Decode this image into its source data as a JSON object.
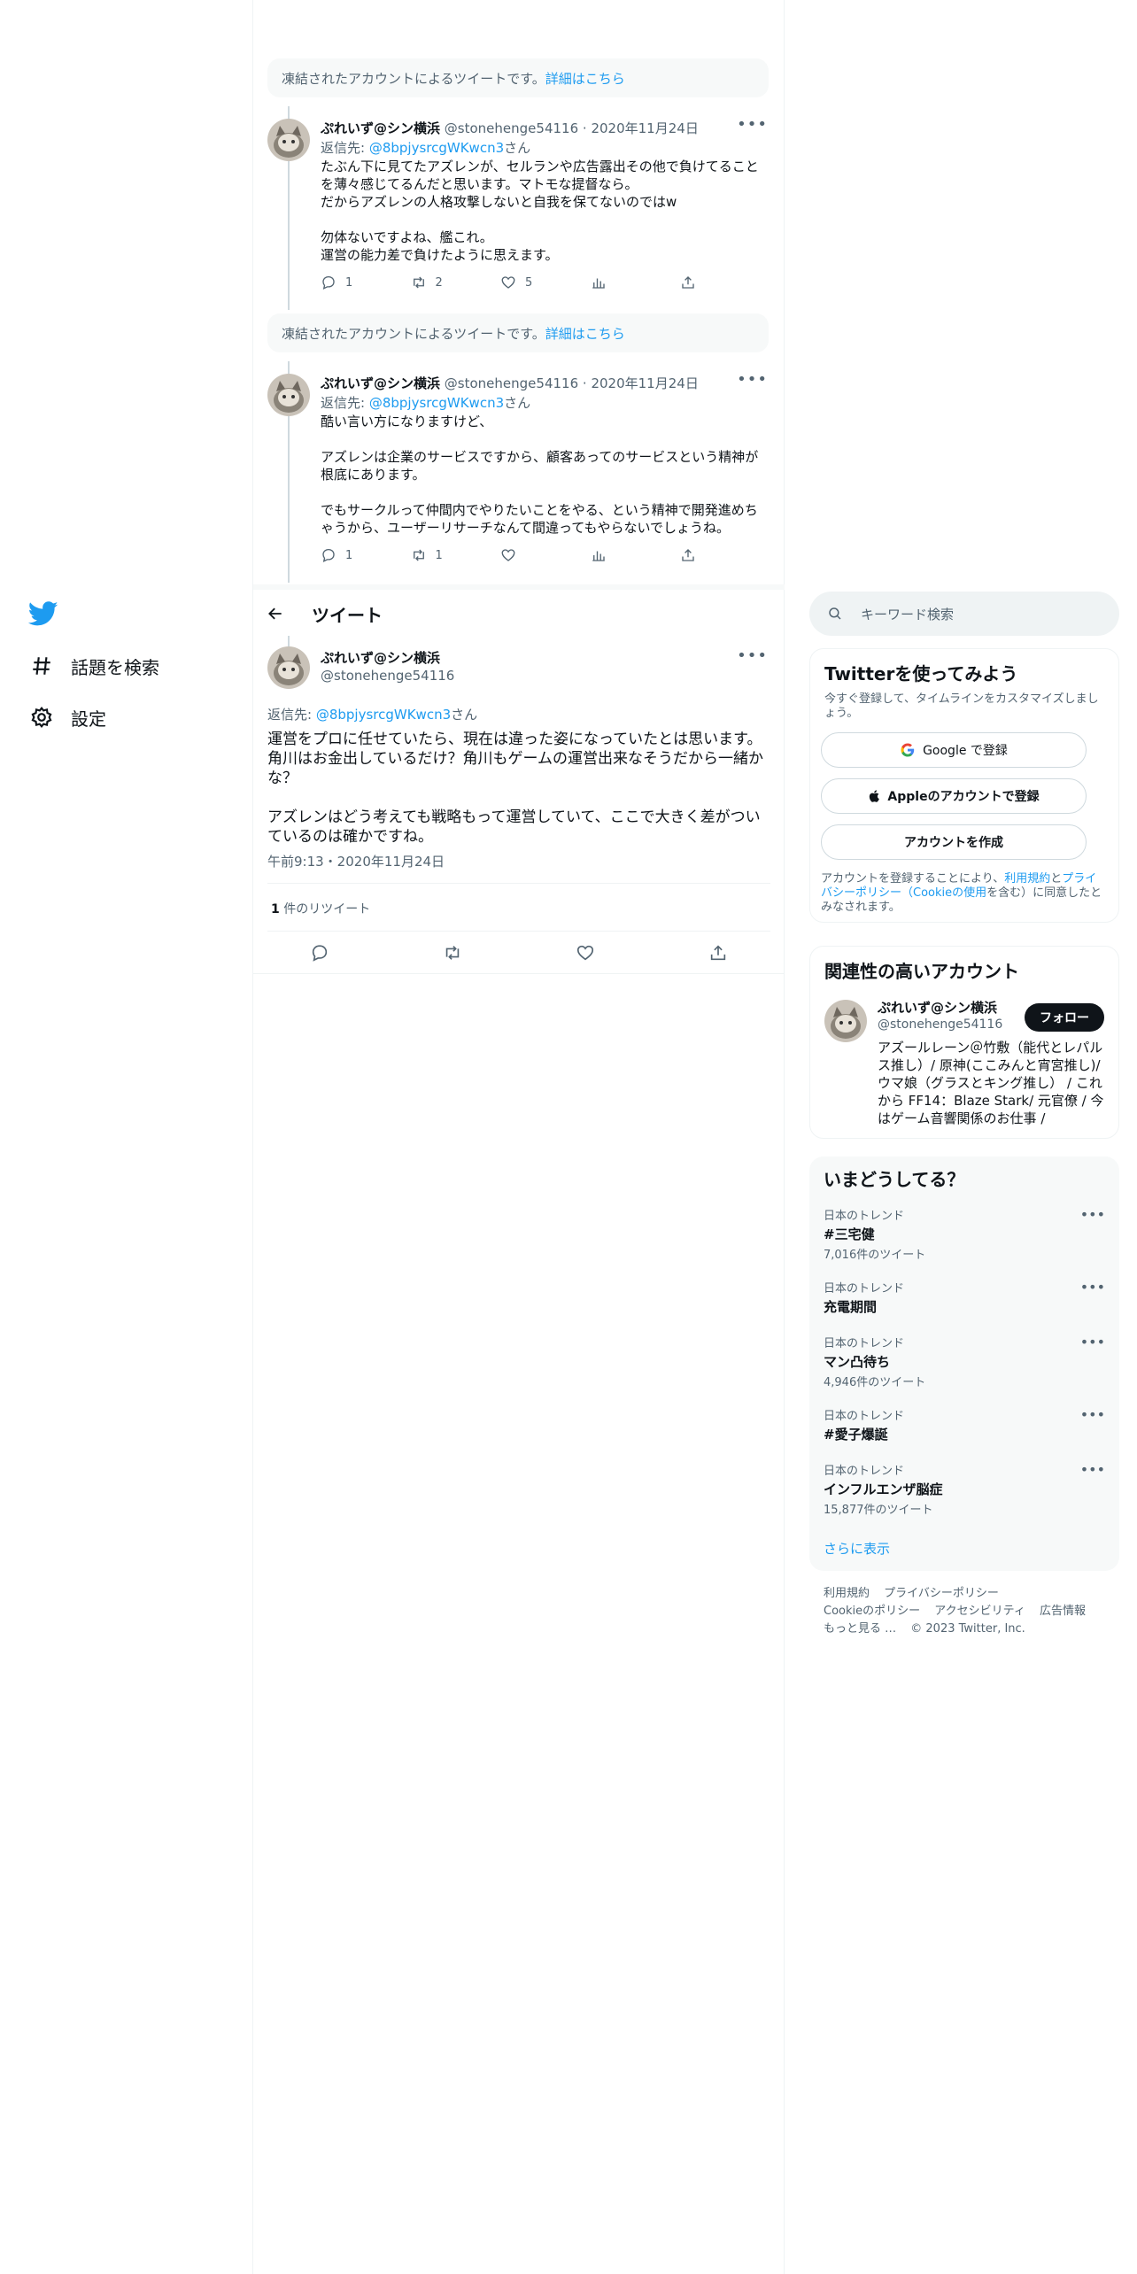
{
  "colors": {
    "accent": "#1d9bf0",
    "text": "#0f1419",
    "muted": "#536471",
    "border": "#eff3f4"
  },
  "nav": {
    "logo_icon": "twitter-bird-icon",
    "items": [
      {
        "icon": "hashtag-icon",
        "label": "話題を検索"
      },
      {
        "icon": "gear-icon",
        "label": "設定"
      }
    ]
  },
  "thread": {
    "notices": [
      {
        "text": "凍結されたアカウントによるツイートです。",
        "link": "詳細はこちら"
      },
      {
        "text": "凍結されたアカウントによるツイートです。",
        "link": "詳細はこちら"
      }
    ],
    "tweets": [
      {
        "name": "ぷれいず@シン横浜",
        "handle": "@stonehenge54116",
        "date": "2020年11月24日",
        "reply_prefix": "返信先: ",
        "reply_to": "@8bpjysrcgWKwcn3",
        "reply_suffix": "さん",
        "text": "たぶん下に見てたアズレンが、セルランや広告露出その他で負けてることを薄々感じてるんだと思います。マトモな提督なら。\nだからアズレンの人格攻撃しないと自我を保てないのではw\n\n勿体ないですよね、艦これ。\n運営の能力差で負けたように思えます。",
        "replies": "1",
        "retweets": "2",
        "likes": "5"
      },
      {
        "name": "ぷれいず@シン横浜",
        "handle": "@stonehenge54116",
        "date": "2020年11月24日",
        "reply_prefix": "返信先: ",
        "reply_to": "@8bpjysrcgWKwcn3",
        "reply_suffix": "さん",
        "text": "酷い言い方になりますけど、\n\nアズレンは企業のサービスですから、顧客あってのサービスという精神が根底にあります。\n\nでもサークルって仲間内でやりたいことをやる、という精神で開発進めちゃうから、ユーザーリサーチなんて間違ってもやらないでしょうね。",
        "replies": "1",
        "retweets": "1",
        "likes": ""
      }
    ]
  },
  "header": {
    "title": "ツイート"
  },
  "focus": {
    "name": "ぷれいず@シン横浜",
    "handle": "@stonehenge54116",
    "reply_prefix": "返信先: ",
    "reply_to": "@8bpjysrcgWKwcn3",
    "reply_suffix": "さん",
    "text": "運営をプロに任せていたら、現在は違った姿になっていたとは思います。角川はお金出しているだけ？角川もゲームの運営出来なそうだから一緒かな？\n\nアズレンはどう考えても戦略もって運営していて、ここで大きく差がついているのは確かですね。",
    "timestamp": "午前9:13・2020年11月24日",
    "retweet_count": "1",
    "retweet_label": " 件のリツイート"
  },
  "search": {
    "placeholder": "キーワード検索"
  },
  "signup": {
    "title": "Twitterを使ってみよう",
    "subtitle": "今すぐ登録して、タイムラインをカスタマイズしましょう。",
    "google": "Google で登録",
    "apple": "Appleのアカウントで登録",
    "create": "アカウントを作成",
    "terms_1": "アカウントを登録することにより、",
    "terms_link1": "利用規約",
    "terms_and": "と",
    "terms_link2": "プライバシーポリシー（Cookieの使用",
    "terms_2": "を含む）に同意したとみなされます。"
  },
  "related": {
    "title": "関連性の高いアカウント",
    "name": "ぷれいず@シン横浜",
    "handle": "@stonehenge54116",
    "follow": "フォロー",
    "bio": "アズールレーン＠竹敷（能代とレパルス推し）/ 原神(ここみんと宵宮推し)/ ウマ娘（グラスとキング推し） / これから FF14：Blaze Stark/ 元官僚 / 今はゲーム音響関係のお仕事 /"
  },
  "trends": {
    "title": "いまどうしてる？",
    "items": [
      {
        "category": "日本のトレンド",
        "name": "#三宅健",
        "count": "7,016件のツイート"
      },
      {
        "category": "日本のトレンド",
        "name": "充電期間",
        "count": ""
      },
      {
        "category": "日本のトレンド",
        "name": "マン凸待ち",
        "count": "4,946件のツイート"
      },
      {
        "category": "日本のトレンド",
        "name": "#愛子爆誕",
        "count": ""
      },
      {
        "category": "日本のトレンド",
        "name": "インフルエンザ脳症",
        "count": "15,877件のツイート"
      }
    ],
    "show_more": "さらに表示"
  },
  "footer": {
    "terms": "利用規約",
    "privacy": "プライバシーポリシー",
    "cookie": "Cookieのポリシー",
    "accessibility": "アクセシビリティ",
    "ads": "広告情報",
    "more": "もっと見る …",
    "copyright": "© 2023 Twitter, Inc."
  }
}
